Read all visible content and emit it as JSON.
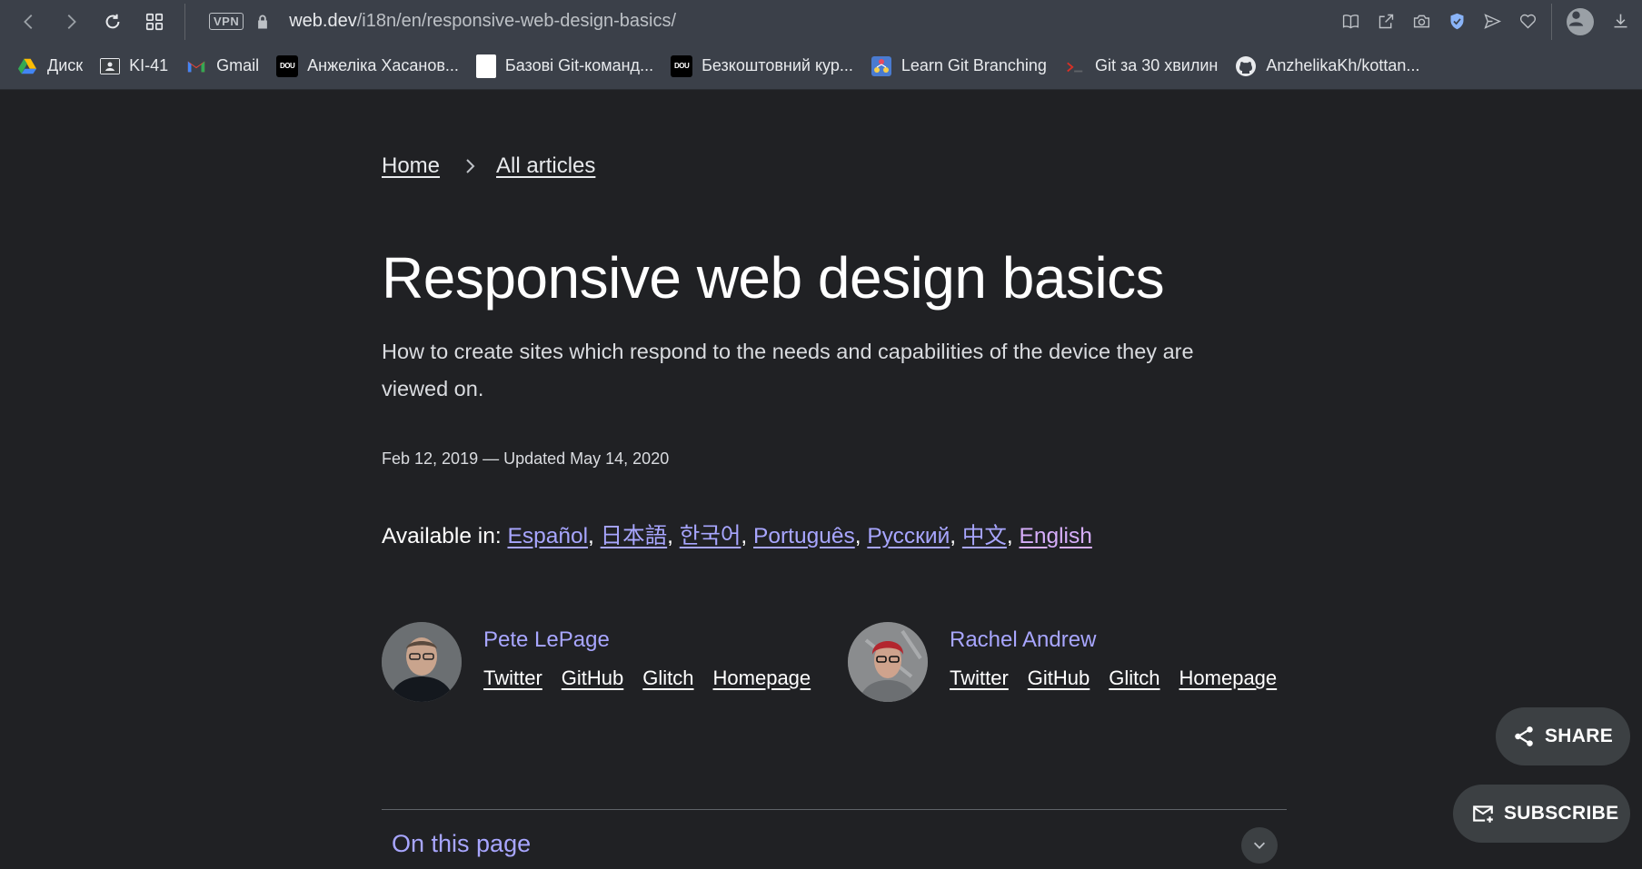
{
  "browser": {
    "vpn_label": "VPN",
    "url_host": "web.dev",
    "url_path": "/i18n/en/responsive-web-design-basics/"
  },
  "bookmarks": [
    {
      "label": "Диск",
      "icon": "google-drive-icon"
    },
    {
      "label": "KI-41",
      "icon": "classroom-icon"
    },
    {
      "label": "Gmail",
      "icon": "gmail-icon"
    },
    {
      "label": "Анжеліка Хасанов...",
      "icon": "dou-icon"
    },
    {
      "label": "Базові Git-команд...",
      "icon": "document-icon"
    },
    {
      "label": "Безкоштовний кур...",
      "icon": "dou-icon"
    },
    {
      "label": "Learn Git Branching",
      "icon": "git-branching-icon"
    },
    {
      "label": "Git за 30 хвилин",
      "icon": "terminal-icon"
    },
    {
      "label": "AnzhelikaKh/kottan...",
      "icon": "github-icon"
    }
  ],
  "dou_badge": "DOU",
  "breadcrumb": {
    "home": "Home",
    "all_articles": "All articles"
  },
  "article": {
    "title": "Responsive web design basics",
    "subtitle": "How to create sites which respond to the needs and capabilities of the device they are viewed on.",
    "date": "Feb 12, 2019 — Updated May 14, 2020"
  },
  "available": {
    "label": "Available in:",
    "languages": [
      "Español",
      "日本語",
      "한국어",
      "Português",
      "Русский",
      "中文",
      "English"
    ]
  },
  "authors": [
    {
      "name": "Pete LePage",
      "links": [
        "Twitter",
        "GitHub",
        "Glitch",
        "Homepage"
      ]
    },
    {
      "name": "Rachel Andrew",
      "links": [
        "Twitter",
        "GitHub",
        "Glitch",
        "Homepage"
      ]
    }
  ],
  "on_this_page": "On this page",
  "share_label": "SHARE",
  "subscribe_label": "SUBSCRIBE",
  "colors": {
    "background": "#202124",
    "link_accent": "#a8a6ff",
    "chrome": "#3b4049"
  }
}
